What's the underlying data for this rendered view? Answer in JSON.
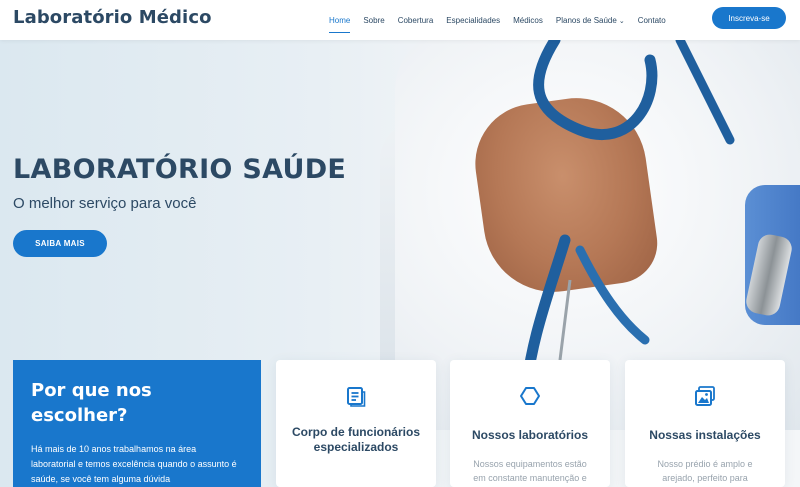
{
  "header": {
    "logo": "Laboratório Médico",
    "nav": [
      {
        "label": "Home",
        "active": true
      },
      {
        "label": "Sobre",
        "active": false
      },
      {
        "label": "Cobertura",
        "active": false
      },
      {
        "label": "Especialidades",
        "active": false
      },
      {
        "label": "Médicos",
        "active": false
      },
      {
        "label": "Planos de Saúde",
        "active": false
      },
      {
        "label": "Contato",
        "active": false
      }
    ],
    "nav_chevron": "⌄",
    "cta": "Inscreva-se"
  },
  "hero": {
    "title": "LABORATÓRIO SAÚDE",
    "subtitle": "O melhor serviço para você",
    "button": "SAIBA MAIS"
  },
  "why": {
    "title": "Por que nos escolher?",
    "text": "Há mais de 10 anos trabalhamos na área laboratorial e temos excelência quando o assunto é saúde, se você tem alguma dúvida"
  },
  "cards": [
    {
      "icon": "document-icon",
      "title": "Corpo de funcionários especializados",
      "text": ""
    },
    {
      "icon": "cube-icon",
      "title": "Nossos laboratórios",
      "text": "Nossos equipamentos estão em constante manutenção e"
    },
    {
      "icon": "images-icon",
      "title": "Nossas instalações",
      "text": "Nosso prédio é amplo e arejado, perfeito para"
    }
  ],
  "colors": {
    "accent": "#1977cc",
    "heading": "#2c4964",
    "muted": "#98a3ad"
  }
}
